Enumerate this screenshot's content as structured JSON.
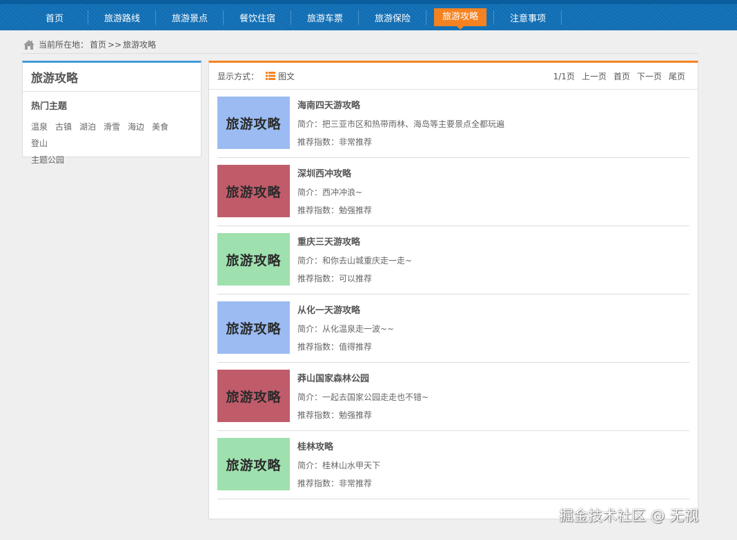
{
  "nav": {
    "items": [
      {
        "label": "首页"
      },
      {
        "label": "旅游路线"
      },
      {
        "label": "旅游景点"
      },
      {
        "label": "餐饮住宿"
      },
      {
        "label": "旅游车票"
      },
      {
        "label": "旅游保险"
      },
      {
        "label": "旅游攻略"
      },
      {
        "label": "注意事项"
      }
    ],
    "active_index": 6
  },
  "breadcrumb": {
    "label": "当前所在地：",
    "home": "首页",
    "separator": ">>",
    "current": "旅游攻略"
  },
  "sidebar": {
    "title": "旅游攻略",
    "subtitle": "热门主题",
    "tags": [
      "温泉",
      "古镇",
      "湖泊",
      "滑雪",
      "海边",
      "美食",
      "登山",
      "主题公园"
    ]
  },
  "toolbar": {
    "display_label": "显示方式：",
    "display_mode": "图文",
    "pager": {
      "page_info": "1/1页",
      "prev": "上一页",
      "first": "首页",
      "next": "下一页",
      "last": "尾页"
    }
  },
  "items": [
    {
      "thumb_text": "旅游攻略",
      "thumb_color": "#9bbbf2",
      "title": "海南四天游攻略",
      "desc": "简介：把三亚市区和热带雨林、海岛等主要景点全都玩遍",
      "rec": "推荐指数：非常推荐"
    },
    {
      "thumb_text": "旅游攻略",
      "thumb_color": "#c05b6a",
      "title": "深圳西冲攻略",
      "desc": "简介：西冲冲浪~",
      "rec": "推荐指数：勉强推荐"
    },
    {
      "thumb_text": "旅游攻略",
      "thumb_color": "#9ee0ae",
      "title": "重庆三天游攻略",
      "desc": "简介：和你去山城重庆走一走~",
      "rec": "推荐指数：可以推荐"
    },
    {
      "thumb_text": "旅游攻略",
      "thumb_color": "#9bbbf2",
      "title": "从化一天游攻略",
      "desc": "简介：从化温泉走一波~~",
      "rec": "推荐指数：值得推荐"
    },
    {
      "thumb_text": "旅游攻略",
      "thumb_color": "#c05b6a",
      "title": "莽山国家森林公园",
      "desc": "简介：一起去国家公园走走也不错~",
      "rec": "推荐指数：勉强推荐"
    },
    {
      "thumb_text": "旅游攻略",
      "thumb_color": "#9ee0ae",
      "title": "桂林攻略",
      "desc": "简介：桂林山水甲天下",
      "rec": "推荐指数：非常推荐"
    }
  ],
  "watermark": "掘金技术社区 @ 无视",
  "colors": {
    "nav_bg": "#0f6db3",
    "active_tab": "#f58220",
    "sidebar_accent": "#3d9ad8"
  }
}
